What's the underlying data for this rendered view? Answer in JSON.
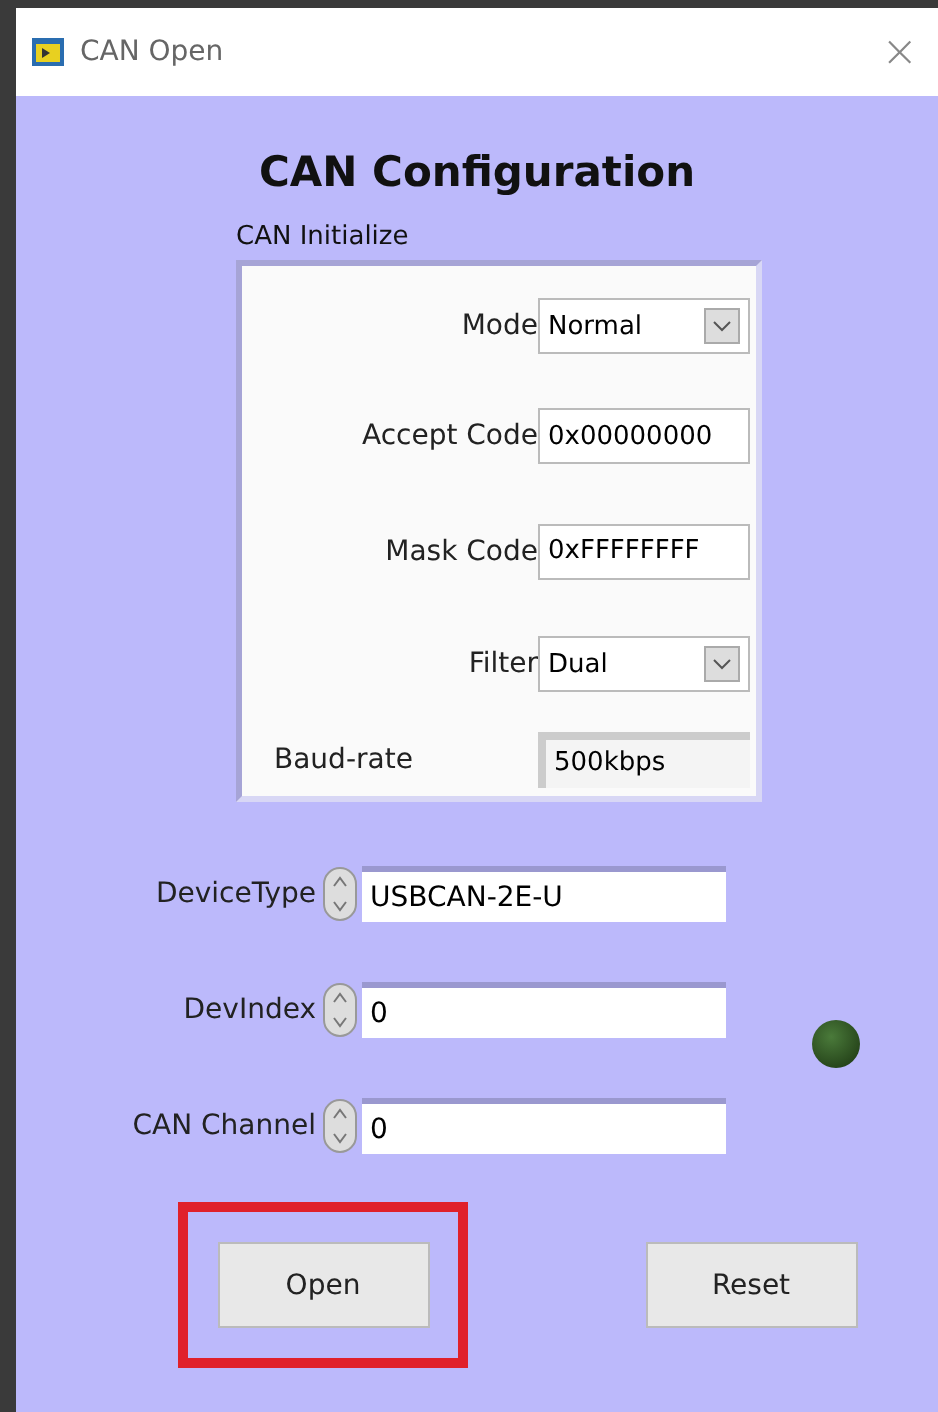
{
  "window": {
    "title": "CAN Open",
    "close": "×"
  },
  "heading": "CAN Configuration",
  "group": {
    "title": "CAN Initialize",
    "rows": [
      {
        "label": "Mode",
        "kind": "dropdown",
        "value": "Normal"
      },
      {
        "label": "Accept Code",
        "kind": "input",
        "value": "0x00000000"
      },
      {
        "label": "Mask Code",
        "kind": "input",
        "value": "0xFFFFFFFF"
      },
      {
        "label": "Filter",
        "kind": "dropdown",
        "value": "Dual"
      },
      {
        "label": "Baud-rate",
        "kind": "readonly",
        "value": "500kbps"
      }
    ]
  },
  "numerics": [
    {
      "label": "DeviceType",
      "value": "USBCAN-2E-U"
    },
    {
      "label": "DevIndex",
      "value": "0"
    },
    {
      "label": "CAN Channel",
      "value": "0"
    }
  ],
  "indicator": {
    "on": false
  },
  "buttons": [
    {
      "label": "Open",
      "highlighted": true
    },
    {
      "label": "Reset",
      "highlighted": false
    }
  ]
}
